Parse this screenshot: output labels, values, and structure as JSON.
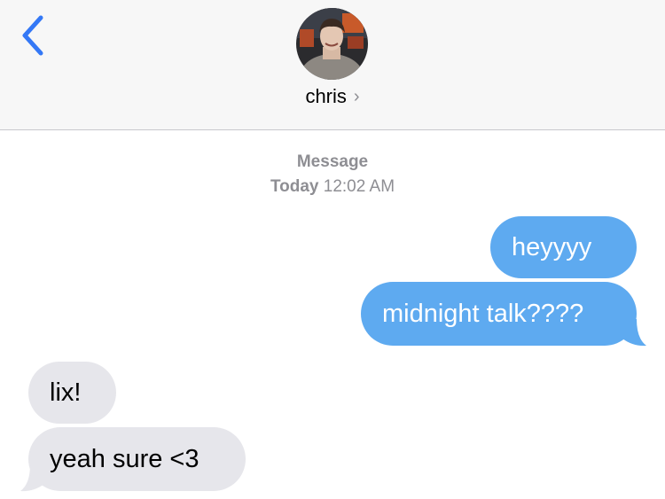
{
  "header": {
    "contact_name": "chris",
    "chevron": "›",
    "back_icon": "chevron-left-icon",
    "accent_color": "#3478f6"
  },
  "thread": {
    "service_label": "Message",
    "timestamp_day": "Today",
    "timestamp_time": "12:02 AM"
  },
  "messages": [
    {
      "direction": "outgoing",
      "text": "heyyyy"
    },
    {
      "direction": "outgoing",
      "text": "midnight talk????"
    },
    {
      "direction": "incoming",
      "text": "lix!"
    },
    {
      "direction": "incoming",
      "text": "yeah sure <3"
    }
  ],
  "colors": {
    "outgoing_bubble": "#5eaaf0",
    "incoming_bubble": "#e6e6eb",
    "header_bg": "#f7f7f7",
    "meta_text": "#8e8e93"
  }
}
